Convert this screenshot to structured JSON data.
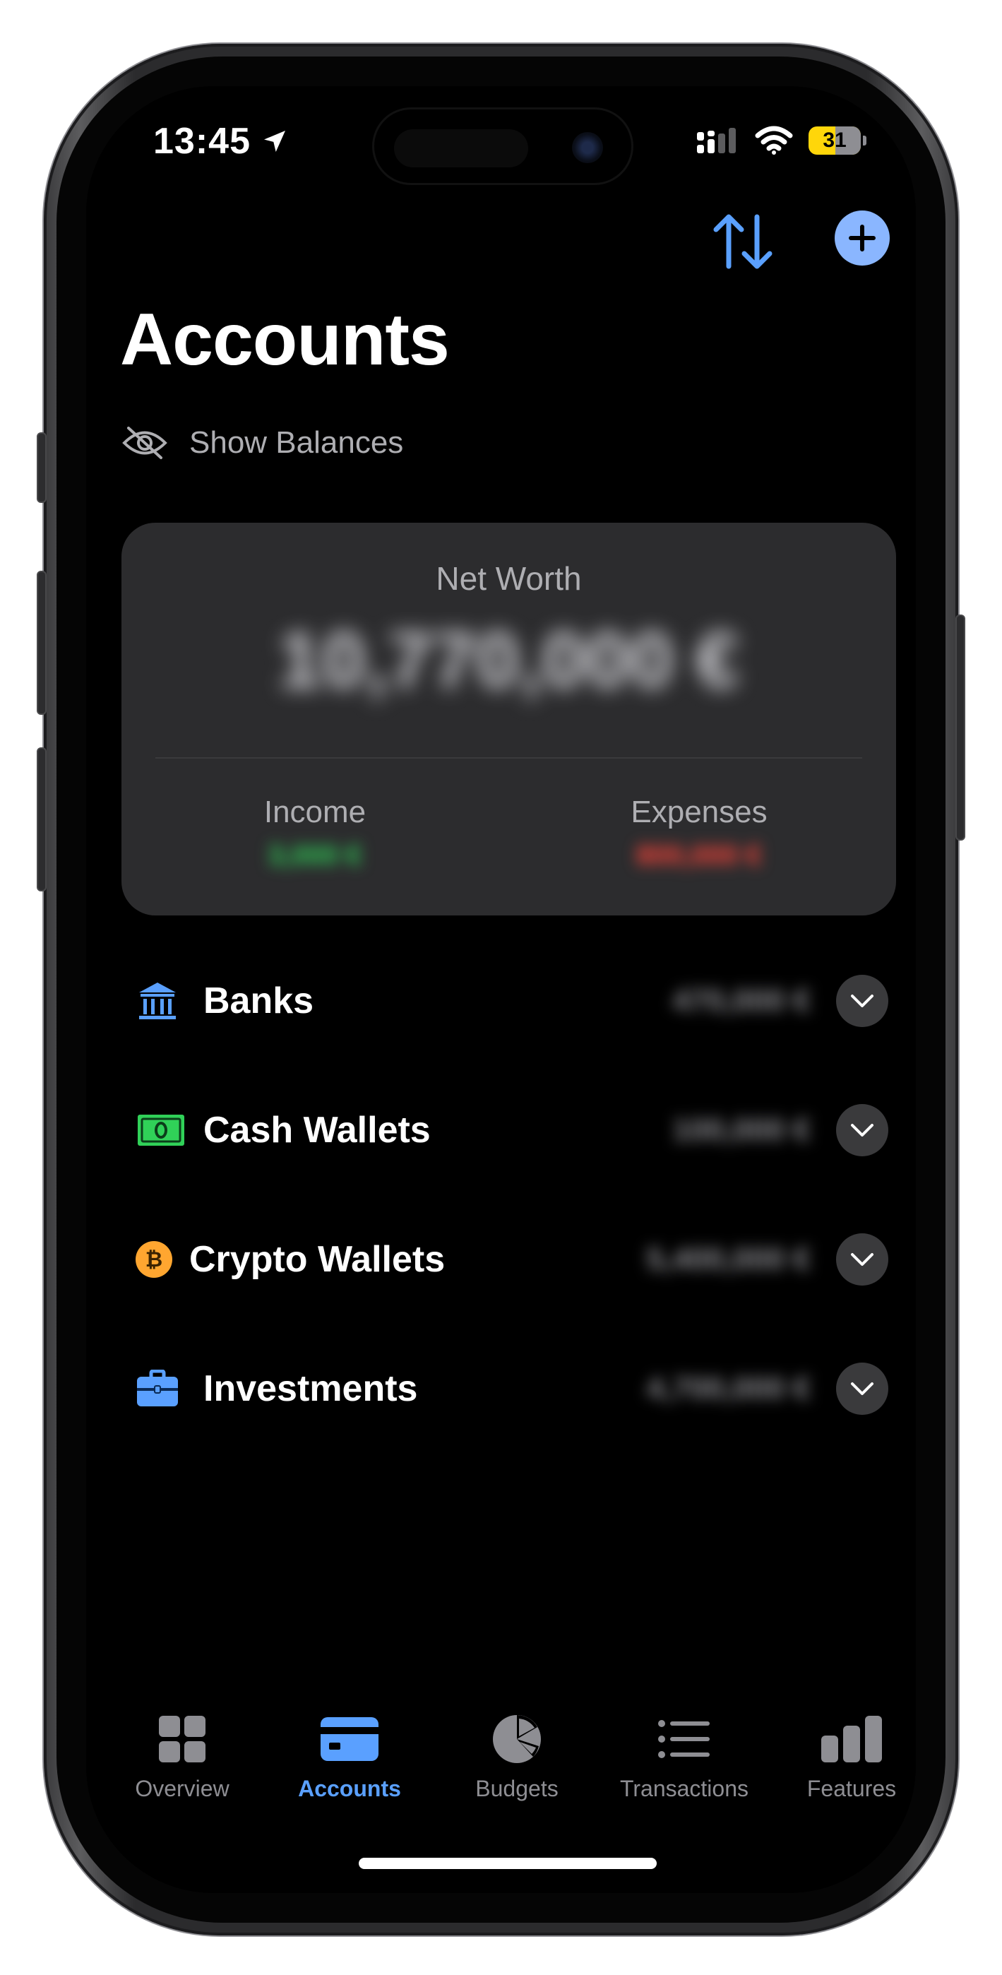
{
  "status_bar": {
    "time": "13:45",
    "battery": "31"
  },
  "header": {
    "title": "Accounts",
    "show_balances": "Show Balances"
  },
  "net_worth": {
    "label": "Net Worth",
    "value": "10,770,000 €",
    "income_label": "Income",
    "income_value": "3,000 €",
    "expenses_label": "Expenses",
    "expenses_value": "800,000 €"
  },
  "groups": [
    {
      "label": "Banks",
      "amount": "470,000 €",
      "icon": "bank-icon"
    },
    {
      "label": "Cash Wallets",
      "amount": "100,000 €",
      "icon": "banknote-icon"
    },
    {
      "label": "Crypto Wallets",
      "amount": "5,400,000 €",
      "icon": "bitcoin-icon"
    },
    {
      "label": "Investments",
      "amount": "4,700,000 €",
      "icon": "briefcase-icon"
    }
  ],
  "tabs": [
    {
      "label": "Overview",
      "icon": "grid-icon"
    },
    {
      "label": "Accounts",
      "icon": "card-icon"
    },
    {
      "label": "Budgets",
      "icon": "pie-icon"
    },
    {
      "label": "Transactions",
      "icon": "list-icon"
    },
    {
      "label": "Features",
      "icon": "bars-icon"
    }
  ],
  "colors": {
    "accent": "#5aa0ff",
    "income": "#30d158",
    "expenses": "#ff453a",
    "card": "#2c2c2e"
  }
}
